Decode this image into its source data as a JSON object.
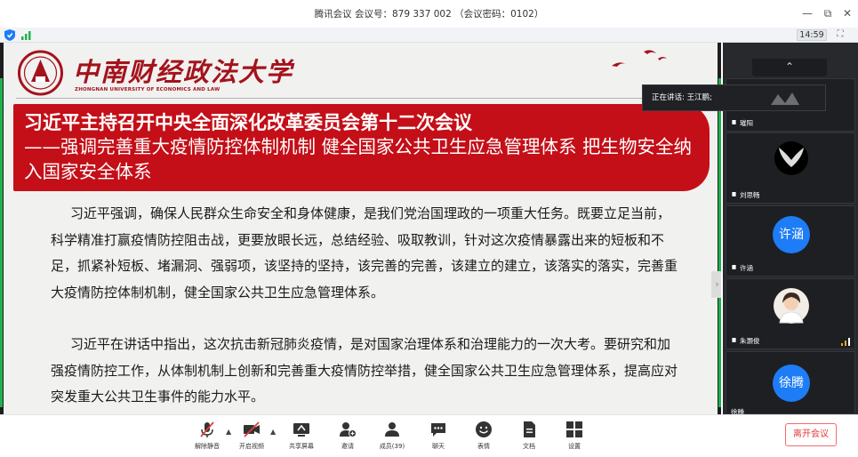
{
  "window": {
    "title": "腾讯会议 会议号：879 337 002 （会议密码：0102）",
    "minimize_icon": "minimize-icon",
    "restore_icon": "restore-icon",
    "close_icon": "close-icon"
  },
  "status": {
    "time": "14:59"
  },
  "slide": {
    "university_cn": "中南财经政法大学",
    "university_en": "ZHONGNAN UNIVERSITY OF ECONOMICS AND LAW",
    "heading1": "习近平主持召开中央全面深化改革委员会第十二次会议",
    "heading2": "——强调完善重大疫情防控体制机制 健全国家公共卫生应急管理体系 把生物安全纳入国家安全体系",
    "paragraph1": "习近平强调，确保人民群众生命安全和身体健康，是我们党治国理政的一项重大任务。既要立足当前，科学精准打赢疫情防控阻击战，更要放眼长远，总结经验、吸取教训，针对这次疫情暴露出来的短板和不足，抓紧补短板、堵漏洞、强弱项，该坚持的坚持，该完善的完善，该建立的建立，该落实的落实，完善重大疫情防控体制机制，健全国家公共卫生应急管理体系。",
    "paragraph2": "习近平在讲话中指出，这次抗击新冠肺炎疫情，是对国家治理体系和治理能力的一次大考。要研究和加强疫情防控工作，从体制机制上创新和完善重大疫情防控举措，健全国家公共卫生应急管理体系，提高应对突发重大公共卫生事件的能力水平。"
  },
  "panel": {
    "speaking_label": "正在讲话: 王江鹏;",
    "participants": [
      {
        "name": "璀阳"
      },
      {
        "name": "刘思畅"
      },
      {
        "name": "许涵",
        "avatar_text": "许涵"
      },
      {
        "name": "朱灏俊"
      },
      {
        "name": "徐腾",
        "avatar_text": "徐腾"
      }
    ]
  },
  "toolbar": {
    "mute_label": "解除静音",
    "video_label": "开启视频",
    "share_label": "共享屏幕",
    "invite_label": "邀请",
    "members_label": "成员(39)",
    "chat_label": "聊天",
    "emoji_label": "表情",
    "docs_label": "文档",
    "settings_label": "设置",
    "leave_label": "离开会议"
  }
}
